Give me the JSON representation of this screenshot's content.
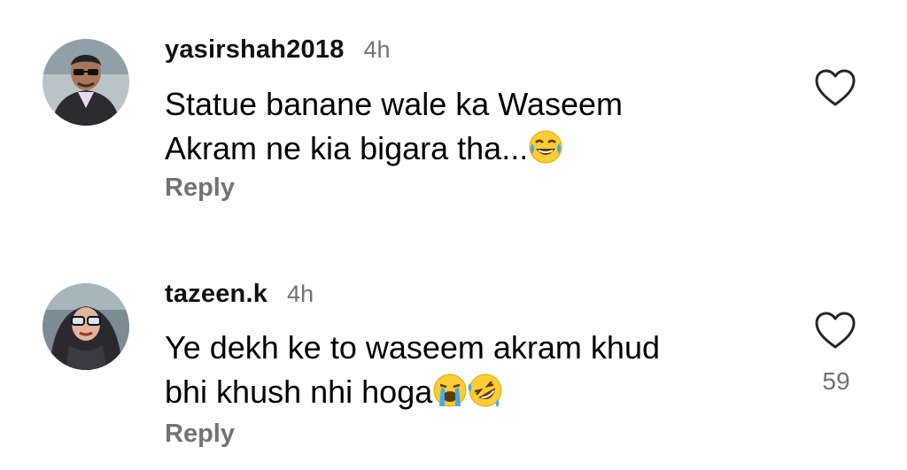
{
  "comments": [
    {
      "username": "yasirshah2018",
      "time": "4h",
      "text_line1": "Statue banane wale ka Waseem",
      "text_line2": "Akram ne kia bigara tha...",
      "reply_label": "Reply",
      "emojis": [
        "face-with-tears-of-joy"
      ]
    },
    {
      "username": "tazeen.k",
      "time": "4h",
      "text_line1": "Ye dekh ke to waseem akram khud",
      "text_line2": "bhi khush nhi hoga",
      "reply_label": "Reply",
      "likes": "59",
      "emojis": [
        "loudly-crying-face",
        "rolling-on-the-floor-laughing"
      ]
    }
  ],
  "icons": {
    "like": "heart-outline-icon"
  }
}
